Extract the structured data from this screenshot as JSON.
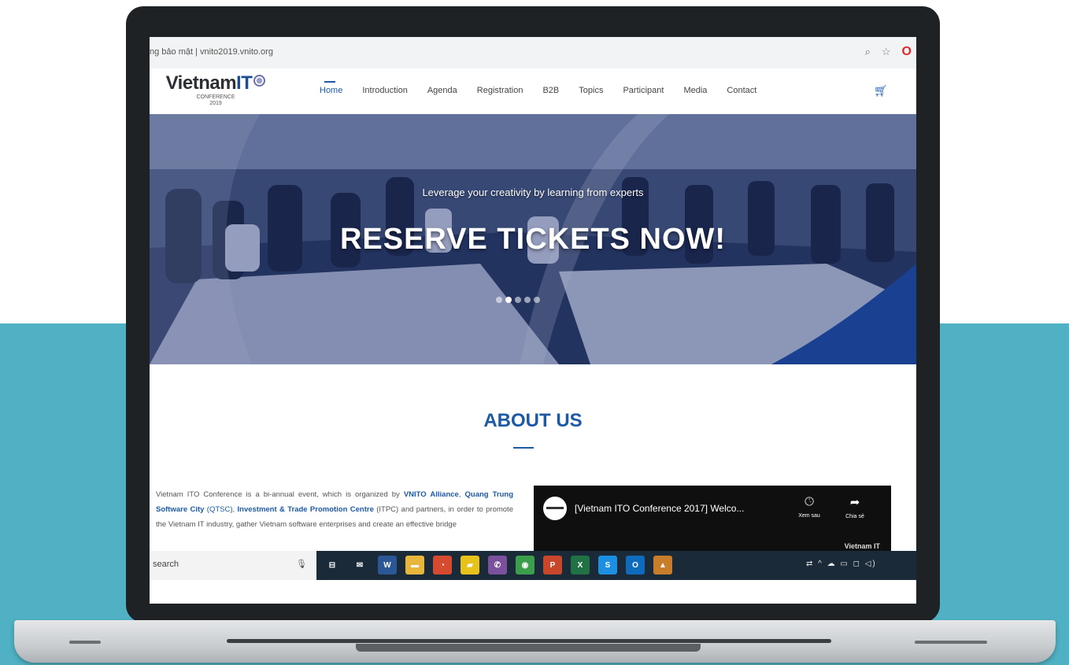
{
  "browser": {
    "url": "ng bảo mật | vnito2019.vnito.org"
  },
  "site": {
    "logo": {
      "brand": "Vietnam",
      "it": "IT",
      "sub1": "CONFERENCE",
      "sub2": "2019"
    },
    "nav": [
      {
        "label": "Home",
        "active": true
      },
      {
        "label": "Introduction"
      },
      {
        "label": "Agenda"
      },
      {
        "label": "Registration"
      },
      {
        "label": "B2B"
      },
      {
        "label": "Topics"
      },
      {
        "label": "Participant"
      },
      {
        "label": "Media"
      },
      {
        "label": "Contact"
      }
    ],
    "cart_icon": "cart-icon"
  },
  "hero": {
    "subtitle": "Leverage your creativity by learning from experts",
    "title": "RESERVE TICKETS NOW!",
    "slides": 5,
    "active_slide": 2
  },
  "about": {
    "title": "ABOUT US",
    "p_intro": "Vietnam ITO Conference is a bi-annual event, which is organized by ",
    "p_vinito": "VNITO Alliance",
    "p_c1": ", ",
    "p_qtsc": "Quang Trung Software City",
    "p_c2": " ",
    "p_qtsc_abbr": "(QTSC)",
    "p_c3": ", ",
    "p_itpc": "Investment & Trade Promotion Centre",
    "p_rest": " (ITPC) and partners, in order to promote the Vietnam IT industry, gather Vietnam software enterprises and create an effective bridge"
  },
  "video": {
    "title": "[Vietnam ITO Conference 2017] Welco...",
    "watch_later": "Xem sau",
    "share": "Chia sẻ",
    "brand": "Vietnam IT"
  },
  "taskbar": {
    "search": "search",
    "icons": [
      {
        "name": "task-view-icon",
        "glyph": "⊟",
        "color": "#1b2a38"
      },
      {
        "name": "mail-icon",
        "glyph": "✉",
        "color": "#1b2a38"
      },
      {
        "name": "word-icon",
        "glyph": "W",
        "color": "#2b5797"
      },
      {
        "name": "file-explorer-icon",
        "glyph": "▬",
        "color": "#e8b63a"
      },
      {
        "name": "paint-icon",
        "glyph": "◔",
        "color": "#d64a2f"
      },
      {
        "name": "sticky-notes-icon",
        "glyph": "▰",
        "color": "#e6c21a"
      },
      {
        "name": "viber-icon",
        "glyph": "✆",
        "color": "#7b519d"
      },
      {
        "name": "chrome-icon",
        "glyph": "◉",
        "color": "#3a9e4a"
      },
      {
        "name": "powerpoint-icon",
        "glyph": "P",
        "color": "#c8462a"
      },
      {
        "name": "excel-icon",
        "glyph": "X",
        "color": "#207245"
      },
      {
        "name": "skype-icon",
        "glyph": "S",
        "color": "#1d8fe1"
      },
      {
        "name": "outlook-icon",
        "glyph": "O",
        "color": "#0f6cbd"
      },
      {
        "name": "photos-icon",
        "glyph": "▲",
        "color": "#c87d2b"
      }
    ],
    "tray": "⇄  ^ ☁ ▭ ◻ ◁)"
  }
}
